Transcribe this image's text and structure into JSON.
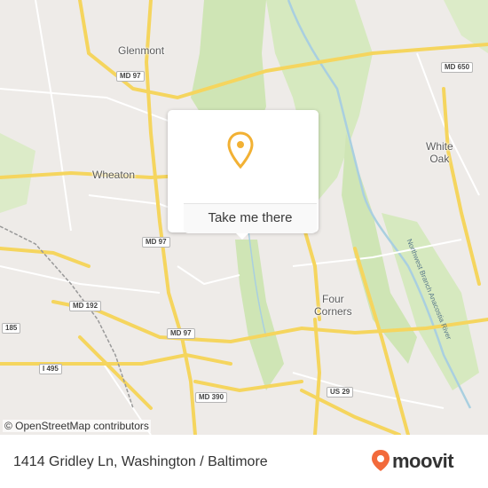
{
  "map": {
    "place_labels": [
      {
        "id": "glenmont",
        "text": "Glenmont"
      },
      {
        "id": "wheaton",
        "text": "Wheaton"
      },
      {
        "id": "white-oak",
        "text": "White\nOak"
      },
      {
        "id": "four-corners",
        "text": "Four\nCorners"
      }
    ],
    "road_shields": [
      {
        "id": "md650",
        "text": "MD 650"
      },
      {
        "id": "md97-north",
        "text": "MD 97"
      },
      {
        "id": "md97-mid",
        "text": "MD 97"
      },
      {
        "id": "md97-south",
        "text": "MD 97"
      },
      {
        "id": "md192",
        "text": "MD 192"
      },
      {
        "id": "i185",
        "text": "185"
      },
      {
        "id": "i495",
        "text": "I 495"
      },
      {
        "id": "md390",
        "text": "MD 390"
      },
      {
        "id": "us29",
        "text": "US 29"
      }
    ],
    "river_label": "Northwest Branch Anacostia River",
    "attribution": "© OpenStreetMap contributors",
    "colors": {
      "background": "#eeebe8",
      "park": "#cfe5b5",
      "major_road": "#f5d55e",
      "minor_road": "#ffffff",
      "water": "#a9cfe0"
    }
  },
  "popup": {
    "button_label": "Take me there",
    "pin_color": "#f2b134"
  },
  "footer": {
    "address": "1414 Gridley Ln, Washington / Baltimore",
    "brand": "moovit",
    "brand_color": "#f26a3b"
  }
}
